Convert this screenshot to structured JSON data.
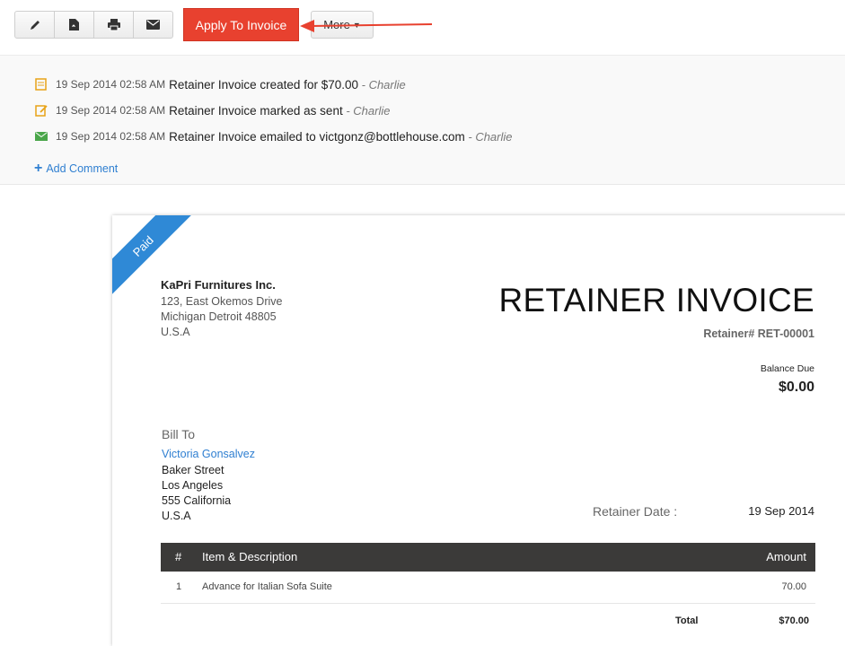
{
  "toolbar": {
    "icons": [
      "pencil-icon",
      "pdf-icon",
      "printer-icon",
      "mail-icon"
    ],
    "apply_label": "Apply To Invoice",
    "more_label": "More",
    "accent": "#e8412f"
  },
  "activity": {
    "items": [
      {
        "time": "19 Sep 2014 02:58 AM",
        "text": "Retainer Invoice created for $70.00",
        "user": "- Charlie",
        "icon": "document-icon"
      },
      {
        "time": "19 Sep 2014 02:58 AM",
        "text": "Retainer Invoice marked as sent",
        "user": "- Charlie",
        "icon": "edit-document-icon"
      },
      {
        "time": "19 Sep 2014 02:58 AM",
        "text": "Retainer Invoice emailed to victgonz@bottlehouse.com",
        "user": "- Charlie",
        "icon": "mail-icon"
      }
    ],
    "add_comment": "Add Comment"
  },
  "document": {
    "ribbon": "Paid",
    "company": {
      "name": "KaPri Furnitures Inc.",
      "address": [
        "123, East Okemos Drive",
        "Michigan Detroit 48805",
        "U.S.A"
      ]
    },
    "title": "RETAINER INVOICE",
    "retainer_no": "Retainer# RET-00001",
    "balance_label": "Balance Due",
    "balance_value": "$0.00",
    "bill_to_label": "Bill To",
    "bill_to_name": "Victoria Gonsalvez",
    "bill_to_address": [
      "Baker Street",
      "Los Angeles",
      "555 California",
      "U.S.A"
    ],
    "date_label": "Retainer Date :",
    "date_value": "19 Sep 2014",
    "table": {
      "headers": {
        "num": "#",
        "item": "Item & Description",
        "amount": "Amount"
      },
      "rows": [
        {
          "num": "1",
          "item": "Advance for Italian Sofa Suite",
          "amount": "70.00"
        }
      ]
    },
    "total_label": "Total",
    "total_value": "$70.00"
  }
}
